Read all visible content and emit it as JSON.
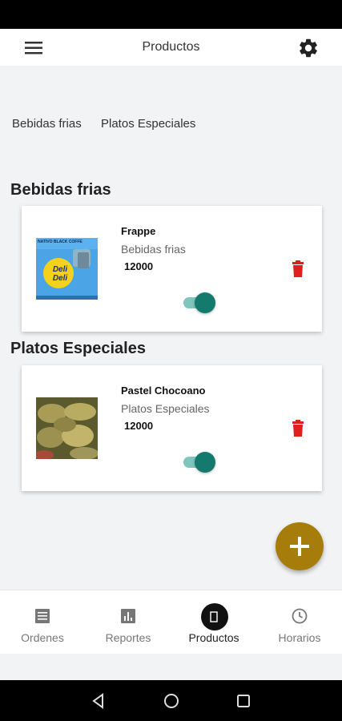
{
  "header": {
    "title": "Productos",
    "menu_icon": "hamburger-menu-icon",
    "settings_icon": "gear-icon"
  },
  "category_tabs": [
    {
      "label": "Bebidas frias"
    },
    {
      "label": "Platos Especiales"
    }
  ],
  "sections": [
    {
      "title": "Bebidas frias",
      "products": [
        {
          "name": "Frappe",
          "category": "Bebidas frias",
          "price": "12000",
          "image_text_top": "NATIVO BLACK COFFE",
          "image_text_logo": "Deli Deli",
          "enabled": true
        }
      ]
    },
    {
      "title": "Platos Especiales",
      "products": [
        {
          "name": "Pastel Chocoano",
          "category": "Platos Especiales",
          "price": "12000",
          "enabled": true
        }
      ]
    }
  ],
  "fab": {
    "icon": "plus-icon",
    "color": "#a67c0a"
  },
  "bottom_nav": [
    {
      "label": "Ordenes",
      "icon": "list-icon",
      "active": false
    },
    {
      "label": "Reportes",
      "icon": "bar-chart-icon",
      "active": false
    },
    {
      "label": "Productos",
      "icon": "product-icon",
      "active": true
    },
    {
      "label": "Horarios",
      "icon": "clock-icon",
      "active": false
    }
  ],
  "colors": {
    "accent": "#a67c0a",
    "toggle_on": "#147a6e",
    "delete": "#e01f1f"
  }
}
